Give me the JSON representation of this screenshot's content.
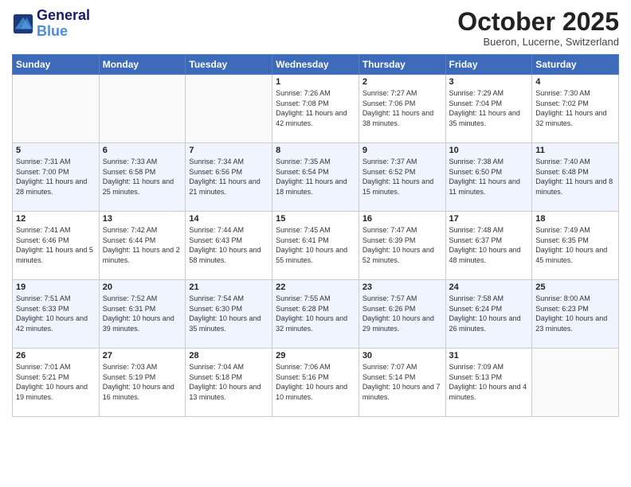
{
  "header": {
    "logo_line1": "General",
    "logo_line2": "Blue",
    "month": "October 2025",
    "location": "Bueron, Lucerne, Switzerland"
  },
  "days_of_week": [
    "Sunday",
    "Monday",
    "Tuesday",
    "Wednesday",
    "Thursday",
    "Friday",
    "Saturday"
  ],
  "weeks": [
    [
      {
        "num": "",
        "info": ""
      },
      {
        "num": "",
        "info": ""
      },
      {
        "num": "",
        "info": ""
      },
      {
        "num": "1",
        "info": "Sunrise: 7:26 AM\nSunset: 7:08 PM\nDaylight: 11 hours and 42 minutes."
      },
      {
        "num": "2",
        "info": "Sunrise: 7:27 AM\nSunset: 7:06 PM\nDaylight: 11 hours and 38 minutes."
      },
      {
        "num": "3",
        "info": "Sunrise: 7:29 AM\nSunset: 7:04 PM\nDaylight: 11 hours and 35 minutes."
      },
      {
        "num": "4",
        "info": "Sunrise: 7:30 AM\nSunset: 7:02 PM\nDaylight: 11 hours and 32 minutes."
      }
    ],
    [
      {
        "num": "5",
        "info": "Sunrise: 7:31 AM\nSunset: 7:00 PM\nDaylight: 11 hours and 28 minutes."
      },
      {
        "num": "6",
        "info": "Sunrise: 7:33 AM\nSunset: 6:58 PM\nDaylight: 11 hours and 25 minutes."
      },
      {
        "num": "7",
        "info": "Sunrise: 7:34 AM\nSunset: 6:56 PM\nDaylight: 11 hours and 21 minutes."
      },
      {
        "num": "8",
        "info": "Sunrise: 7:35 AM\nSunset: 6:54 PM\nDaylight: 11 hours and 18 minutes."
      },
      {
        "num": "9",
        "info": "Sunrise: 7:37 AM\nSunset: 6:52 PM\nDaylight: 11 hours and 15 minutes."
      },
      {
        "num": "10",
        "info": "Sunrise: 7:38 AM\nSunset: 6:50 PM\nDaylight: 11 hours and 11 minutes."
      },
      {
        "num": "11",
        "info": "Sunrise: 7:40 AM\nSunset: 6:48 PM\nDaylight: 11 hours and 8 minutes."
      }
    ],
    [
      {
        "num": "12",
        "info": "Sunrise: 7:41 AM\nSunset: 6:46 PM\nDaylight: 11 hours and 5 minutes."
      },
      {
        "num": "13",
        "info": "Sunrise: 7:42 AM\nSunset: 6:44 PM\nDaylight: 11 hours and 2 minutes."
      },
      {
        "num": "14",
        "info": "Sunrise: 7:44 AM\nSunset: 6:43 PM\nDaylight: 10 hours and 58 minutes."
      },
      {
        "num": "15",
        "info": "Sunrise: 7:45 AM\nSunset: 6:41 PM\nDaylight: 10 hours and 55 minutes."
      },
      {
        "num": "16",
        "info": "Sunrise: 7:47 AM\nSunset: 6:39 PM\nDaylight: 10 hours and 52 minutes."
      },
      {
        "num": "17",
        "info": "Sunrise: 7:48 AM\nSunset: 6:37 PM\nDaylight: 10 hours and 48 minutes."
      },
      {
        "num": "18",
        "info": "Sunrise: 7:49 AM\nSunset: 6:35 PM\nDaylight: 10 hours and 45 minutes."
      }
    ],
    [
      {
        "num": "19",
        "info": "Sunrise: 7:51 AM\nSunset: 6:33 PM\nDaylight: 10 hours and 42 minutes."
      },
      {
        "num": "20",
        "info": "Sunrise: 7:52 AM\nSunset: 6:31 PM\nDaylight: 10 hours and 39 minutes."
      },
      {
        "num": "21",
        "info": "Sunrise: 7:54 AM\nSunset: 6:30 PM\nDaylight: 10 hours and 35 minutes."
      },
      {
        "num": "22",
        "info": "Sunrise: 7:55 AM\nSunset: 6:28 PM\nDaylight: 10 hours and 32 minutes."
      },
      {
        "num": "23",
        "info": "Sunrise: 7:57 AM\nSunset: 6:26 PM\nDaylight: 10 hours and 29 minutes."
      },
      {
        "num": "24",
        "info": "Sunrise: 7:58 AM\nSunset: 6:24 PM\nDaylight: 10 hours and 26 minutes."
      },
      {
        "num": "25",
        "info": "Sunrise: 8:00 AM\nSunset: 6:23 PM\nDaylight: 10 hours and 23 minutes."
      }
    ],
    [
      {
        "num": "26",
        "info": "Sunrise: 7:01 AM\nSunset: 5:21 PM\nDaylight: 10 hours and 19 minutes."
      },
      {
        "num": "27",
        "info": "Sunrise: 7:03 AM\nSunset: 5:19 PM\nDaylight: 10 hours and 16 minutes."
      },
      {
        "num": "28",
        "info": "Sunrise: 7:04 AM\nSunset: 5:18 PM\nDaylight: 10 hours and 13 minutes."
      },
      {
        "num": "29",
        "info": "Sunrise: 7:06 AM\nSunset: 5:16 PM\nDaylight: 10 hours and 10 minutes."
      },
      {
        "num": "30",
        "info": "Sunrise: 7:07 AM\nSunset: 5:14 PM\nDaylight: 10 hours and 7 minutes."
      },
      {
        "num": "31",
        "info": "Sunrise: 7:09 AM\nSunset: 5:13 PM\nDaylight: 10 hours and 4 minutes."
      },
      {
        "num": "",
        "info": ""
      }
    ]
  ]
}
